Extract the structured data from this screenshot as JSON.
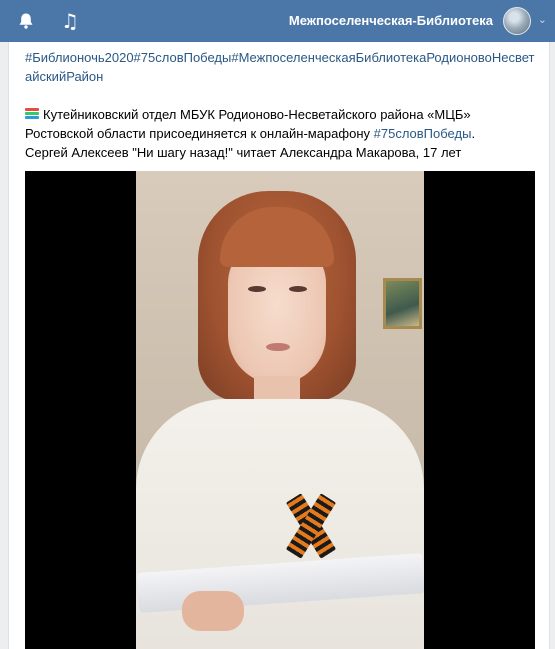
{
  "header": {
    "bell_icon": "bell-icon",
    "music_icon": "music-icon",
    "username": "Межпоселенческая-Библиотека",
    "chevron": "⌄"
  },
  "post": {
    "hashtags": "#Библионочь2020#75словПобеды#МежпоселенческаяБиблиотекаРодионовоНесветайскийРайон",
    "line1": "Кутейниковский отдел МБУК Родионово-Несветайского района «МЦБ»",
    "line2_prefix": "Ростовской области присоединяется к онлайн-марафону ",
    "line2_link": "#75словПобеды",
    "line2_suffix": ".",
    "line3": "Сергей Алексеев \"Ни шагу назад!\" читает Александра Макарова, 17 лет"
  }
}
